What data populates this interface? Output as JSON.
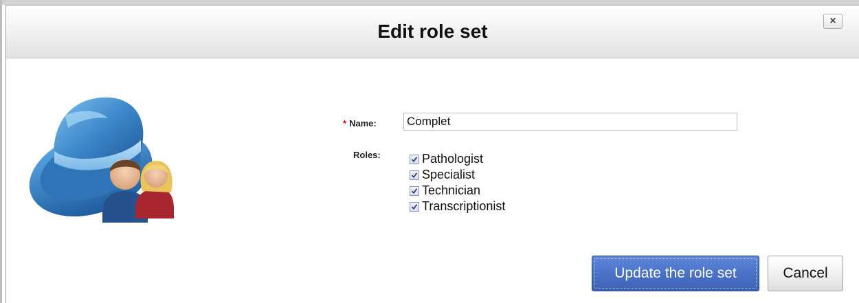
{
  "dialog": {
    "title": "Edit role set",
    "close_label": "×"
  },
  "form": {
    "required_marker": "*",
    "name_label": "Name:",
    "name_value": "Complet",
    "roles_label": "Roles:",
    "roles": [
      {
        "label": "Pathologist",
        "checked": true
      },
      {
        "label": "Specialist",
        "checked": true
      },
      {
        "label": "Technician",
        "checked": true
      },
      {
        "label": "Transcriptionist",
        "checked": true
      }
    ]
  },
  "actions": {
    "update_label": "Update the role set",
    "cancel_label": "Cancel"
  },
  "colors": {
    "primary_button": "#4a72c9",
    "required_marker": "#cc0000",
    "hat": "#3d84c4"
  },
  "icons": {
    "illustration": "role-set-hat-users-icon",
    "checkbox": "checkmark-icon"
  }
}
